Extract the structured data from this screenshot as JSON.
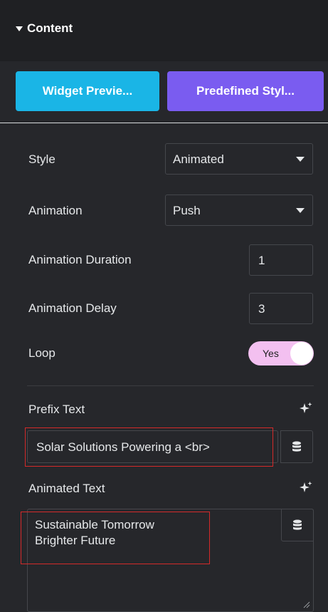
{
  "section": {
    "title": "Content"
  },
  "buttons": {
    "preview": "Widget Previe...",
    "styles": "Predefined Styl..."
  },
  "fields": {
    "style": {
      "label": "Style",
      "value": "Animated"
    },
    "animation": {
      "label": "Animation",
      "value": "Push"
    },
    "duration": {
      "label": "Animation Duration",
      "value": "1"
    },
    "delay": {
      "label": "Animation Delay",
      "value": "3"
    },
    "loop": {
      "label": "Loop",
      "toggle_label": "Yes",
      "enabled": true
    },
    "prefix": {
      "label": "Prefix Text",
      "value": "Solar Solutions Powering a <br>"
    },
    "animated": {
      "label": "Animated Text",
      "lines": [
        "Sustainable Tomorrow",
        "Brighter Future"
      ]
    }
  },
  "icons": {
    "caret": "caret-down-icon",
    "ai": "sparkle-ai-icon",
    "dynamic": "database-icon",
    "resize": "resize-handle-icon"
  },
  "colors": {
    "preview_button": "#1ab5e6",
    "styles_button": "#7a5cf0",
    "toggle_on": "#f3c0f0",
    "highlight": "#d42a2a"
  }
}
